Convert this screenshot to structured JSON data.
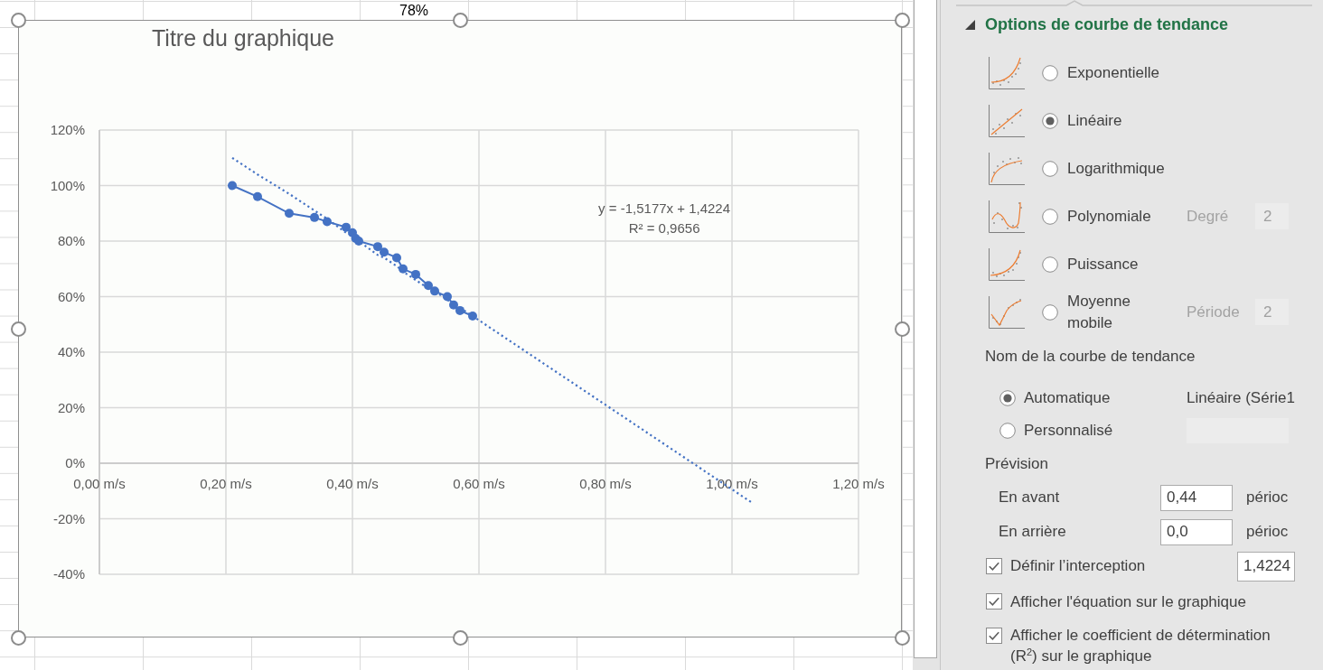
{
  "sheet": {
    "cells": [
      {
        "text": "78%"
      }
    ]
  },
  "chart": {
    "selected": true,
    "chart_data": {
      "type": "line",
      "title": "Titre du graphique",
      "grid": true,
      "x": [
        0.21,
        0.25,
        0.3,
        0.34,
        0.36,
        0.39,
        0.4,
        0.405,
        0.41,
        0.44,
        0.45,
        0.47,
        0.48,
        0.5,
        0.52,
        0.53,
        0.55,
        0.56,
        0.57,
        0.59,
        1.03
      ],
      "series": [
        {
          "color": "#4472c4",
          "line_style": "solid",
          "marker": "circle",
          "values": [
            1.0,
            0.96,
            0.9,
            0.885,
            0.87,
            0.85,
            0.83,
            0.81,
            0.8,
            0.78,
            0.76,
            0.74,
            0.7,
            0.68,
            0.64,
            0.62,
            0.6,
            0.57,
            0.55,
            0.53,
            null
          ]
        },
        {
          "color": "#4472c4",
          "line_style": "dotted",
          "values": [
            1.1,
            1.04,
            0.97,
            0.91,
            0.88,
            0.83,
            0.82,
            0.81,
            0.8,
            0.75,
            0.74,
            0.71,
            0.69,
            0.66,
            0.63,
            0.62,
            0.59,
            0.57,
            0.56,
            0.53,
            -0.14
          ]
        }
      ],
      "xlim": [
        0,
        1.2
      ],
      "ylim": [
        -0.4,
        1.2
      ],
      "xticks": [
        {
          "value": 0,
          "label": "0,00 m/s"
        },
        {
          "value": 0.2,
          "label": "0,20 m/s"
        },
        {
          "value": 0.4,
          "label": "0,40 m/s"
        },
        {
          "value": 0.6,
          "label": "0,60 m/s"
        },
        {
          "value": 0.8,
          "label": "0,80 m/s"
        },
        {
          "value": 1.0,
          "label": "1,00 m/s"
        },
        {
          "value": 1.2,
          "label": "1,20 m/s"
        }
      ],
      "yticks": [
        {
          "value": -0.4,
          "label": "-40%"
        },
        {
          "value": -0.2,
          "label": "-20%"
        },
        {
          "value": 0,
          "label": "0%"
        },
        {
          "value": 0.2,
          "label": "20%"
        },
        {
          "value": 0.4,
          "label": "40%"
        },
        {
          "value": 0.6,
          "label": "60%"
        },
        {
          "value": 0.8,
          "label": "80%"
        },
        {
          "value": 1.0,
          "label": "100%"
        },
        {
          "value": 1.2,
          "label": "120%"
        }
      ],
      "annotations": [
        {
          "text": "y = -1,5177x + 1,4224"
        },
        {
          "text": "R² = 0,9656"
        }
      ]
    }
  },
  "trendline_options": {
    "title": "Options de courbe de tendance",
    "expanded": true,
    "types": [
      {
        "kind": "exponential",
        "label": "Exponentielle",
        "selected": false
      },
      {
        "kind": "linear",
        "label": "Linéaire",
        "selected": true
      },
      {
        "kind": "logarithmic",
        "label": "Logarithmique",
        "selected": false
      },
      {
        "kind": "polynomial",
        "label": "Polynomiale",
        "selected": false,
        "param": {
          "label": "Degré",
          "value": "2",
          "disabled": true
        }
      },
      {
        "kind": "power",
        "label": "Puissance",
        "selected": false
      },
      {
        "kind": "moving_average",
        "label": "Moyenne mobile",
        "selected": false,
        "param": {
          "label": "Période",
          "value": "2",
          "disabled": true
        }
      }
    ],
    "name_heading": "Nom de la courbe de tendance",
    "name_options": [
      {
        "kind": "text",
        "label": "Automatique",
        "selected": true,
        "value": "Linéaire (Série1"
      },
      {
        "kind": "field",
        "label": "Personnalisé",
        "selected": false,
        "field": {
          "disabled": true
        }
      }
    ],
    "forecast_heading": "Prévision",
    "forecast": [
      {
        "label": "En avant",
        "value": "0,44",
        "unit": "périoc"
      },
      {
        "label": "En arrière",
        "value": "0,0",
        "unit": "périoc"
      }
    ],
    "checkboxes": [
      {
        "label": "Définir l’interception",
        "checked": true,
        "value": "1,4224"
      },
      {
        "label": "Afficher l'équation sur le graphique",
        "checked": true
      },
      {
        "label": "Afficher le coefficient de détermination (R$^{2}$) sur le graphique",
        "checked": true
      }
    ]
  }
}
